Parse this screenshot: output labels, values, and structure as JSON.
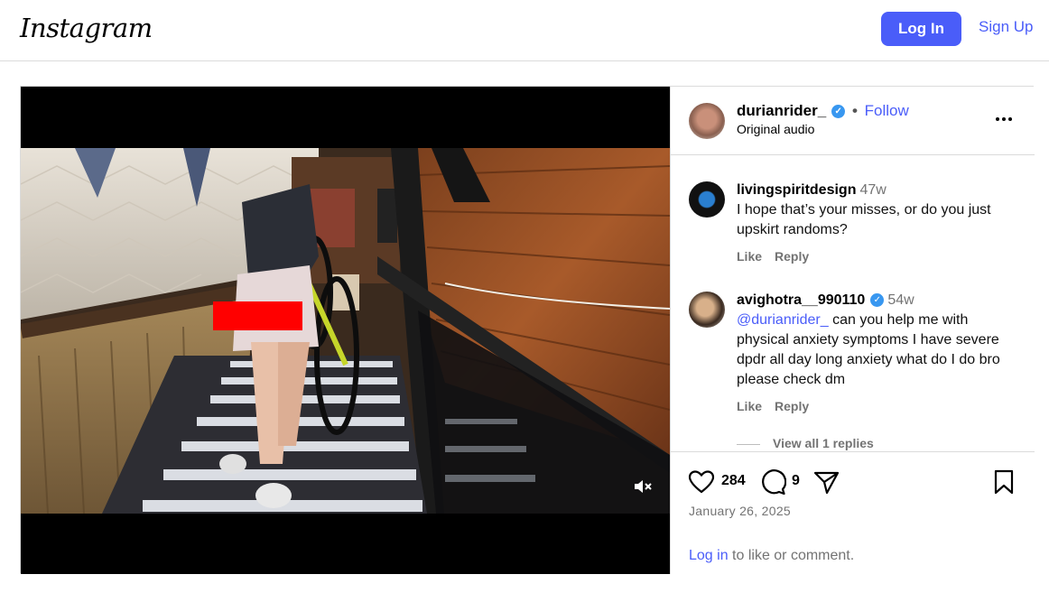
{
  "header": {
    "logo_text": "Instagram",
    "login_label": "Log In",
    "signup_label": "Sign Up"
  },
  "post": {
    "author": {
      "username": "durianrider_",
      "verified": true,
      "separator": "•",
      "follow_label": "Follow",
      "subtitle": "Original audio"
    },
    "comments": [
      {
        "username": "livingspiritdesign",
        "time": "47w",
        "verified": false,
        "mention": "",
        "text": "I hope that’s your misses, or do you just upskirt randoms?",
        "like_label": "Like",
        "reply_label": "Reply"
      },
      {
        "username": "avighotra__990110",
        "time": "54w",
        "verified": true,
        "mention": "@durianrider_",
        "text": " can you help me with physical anxiety symptoms I have severe dpdr all day long anxiety what do I do bro please check dm",
        "like_label": "Like",
        "reply_label": "Reply",
        "view_replies_label": "View all 1 replies"
      }
    ],
    "likes_count": "284",
    "comments_count": "9",
    "date": "January 26, 2025",
    "login_link": "Log in",
    "login_suffix": " to like or comment."
  },
  "icons": {
    "heart": "heart-icon",
    "comment": "comment-icon",
    "share": "share-icon",
    "save": "bookmark-icon",
    "more": "more-options-icon",
    "mute": "muted-speaker-icon"
  },
  "colors": {
    "accent": "#4a5df9",
    "verified": "#3897f0",
    "muted_text": "#737373",
    "border": "#dbdbdb"
  }
}
